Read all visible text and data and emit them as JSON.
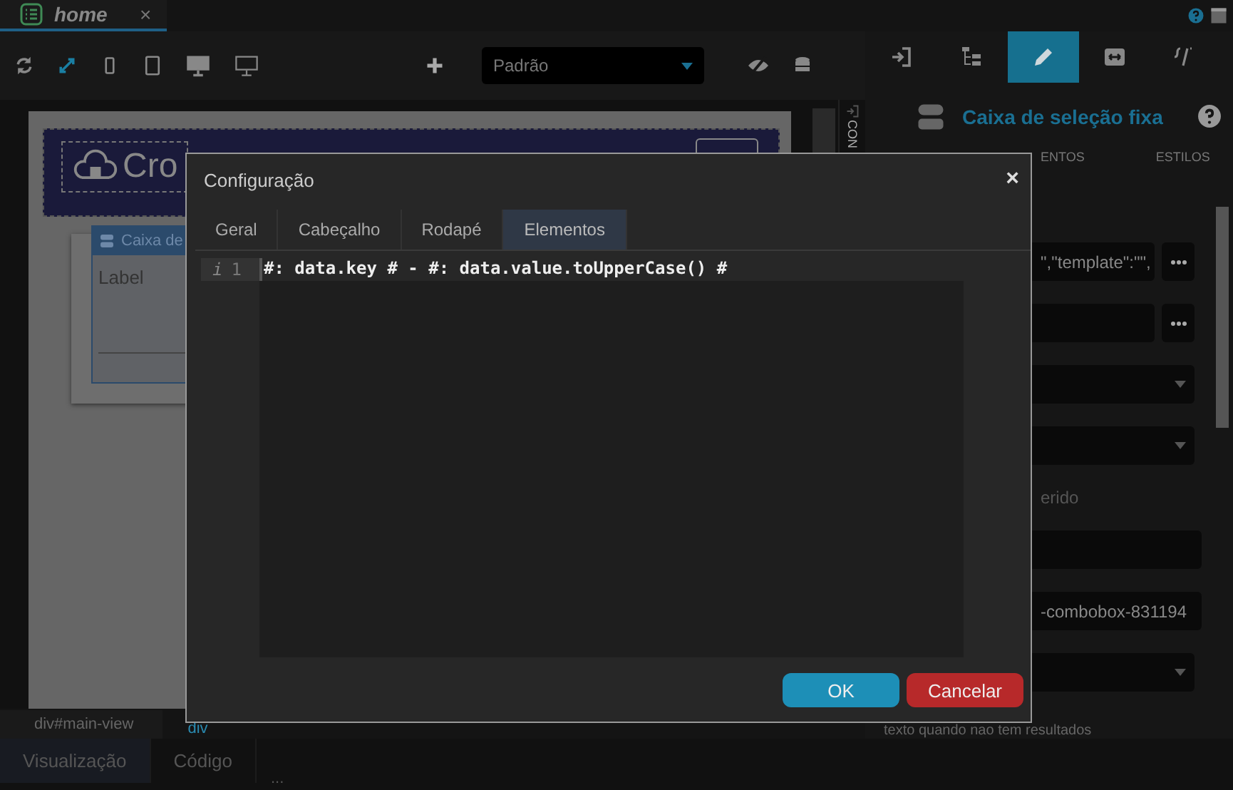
{
  "document_tab": {
    "title": "home",
    "close": "×"
  },
  "toolbar": {
    "theme_select": "Padrão"
  },
  "canvas": {
    "logo_text": "Cro",
    "component_header": "Caixa de",
    "component_label": "Label",
    "side_tab": "CON"
  },
  "breadcrumb": [
    {
      "label": "div#main-view",
      "selected": false
    },
    {
      "label": "div",
      "selected": true
    }
  ],
  "bottom_tabs": [
    {
      "label": "Visualização",
      "selected": true
    },
    {
      "label": "Código",
      "selected": false
    }
  ],
  "bottom_more": "...",
  "panel": {
    "icon_tabs": [
      {
        "selected": false
      },
      {
        "selected": false
      },
      {
        "selected": true
      },
      {
        "selected": false
      },
      {
        "selected": false
      }
    ],
    "title": "Caixa de seleção fixa",
    "section_tabs": [
      "ENTOS",
      "ESTILOS"
    ],
    "fields": [
      {
        "kind": "text-more",
        "value": "\",\"template\":\"\","
      },
      {
        "kind": "text-more"
      },
      {
        "kind": "select"
      },
      {
        "kind": "select"
      },
      {
        "kind": "label",
        "text": "erido"
      },
      {
        "kind": "input"
      },
      {
        "kind": "input",
        "value": "-combobox-831194"
      },
      {
        "kind": "select"
      },
      {
        "kind": "note",
        "text": "texto quando nao tem resultados"
      }
    ]
  },
  "dialog": {
    "title": "Configuração",
    "close": "×",
    "tabs": [
      {
        "label": "Geral",
        "selected": false
      },
      {
        "label": "Cabeçalho",
        "selected": false
      },
      {
        "label": "Rodapé",
        "selected": false
      },
      {
        "label": "Elementos",
        "selected": true
      }
    ],
    "editor_lines": [
      {
        "marker": "i",
        "number": "1",
        "code": "#: data.key # - #: data.value.toUpperCase() #"
      }
    ],
    "buttons": [
      {
        "kind": "primary",
        "label": "OK"
      },
      {
        "kind": "danger",
        "label": "Cancelar"
      }
    ]
  }
}
